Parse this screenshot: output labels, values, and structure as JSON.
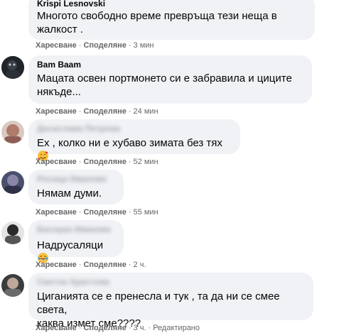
{
  "comments": [
    {
      "author": "Krispi Lesnovski",
      "text_lines": [
        "Многото свободно време превръща тези неща в",
        "жалкост ."
      ],
      "like": "Харесване",
      "share": "Споделяне",
      "time": "3 мин",
      "edited": ""
    },
    {
      "author": "Bam Baam",
      "text_lines": [
        "Мацата освен портмонето си е забравила и циците",
        "някъде..."
      ],
      "like": "Харесване",
      "share": "Споделяне",
      "time": "24 мин",
      "edited": ""
    },
    {
      "author": "Десислава Петрова",
      "text_lines": [
        "Ех , колко ни е хубаво зимата без тях"
      ],
      "emoji": "smiling-face-with-hearts",
      "like": "Харесване",
      "share": "Споделяне",
      "time": "52 мин",
      "edited": ""
    },
    {
      "author": "Росица Иванова",
      "text_lines": [
        "Нямам думи."
      ],
      "like": "Харесване",
      "share": "Споделяне",
      "time": "55 мин",
      "edited": ""
    },
    {
      "author": "Бисерка Иванова",
      "text_lines": [
        "Надрусаляци"
      ],
      "emoji": "laughing-tears",
      "like": "Харесване",
      "share": "Споделяне",
      "time": "2 ч.",
      "edited": ""
    },
    {
      "author": "Светла Христова",
      "text_lines": [
        "Циганията се е пренесла и тук , та да ни се смее света,",
        "каква измет сме????"
      ],
      "like": "Харесване",
      "share": "Споделяне",
      "time": "3 ч.",
      "edited": "Редактирано"
    }
  ],
  "separator": "·",
  "colors": {
    "bubble": "#f0f2f5",
    "meta": "#65676b",
    "text": "#050505"
  }
}
